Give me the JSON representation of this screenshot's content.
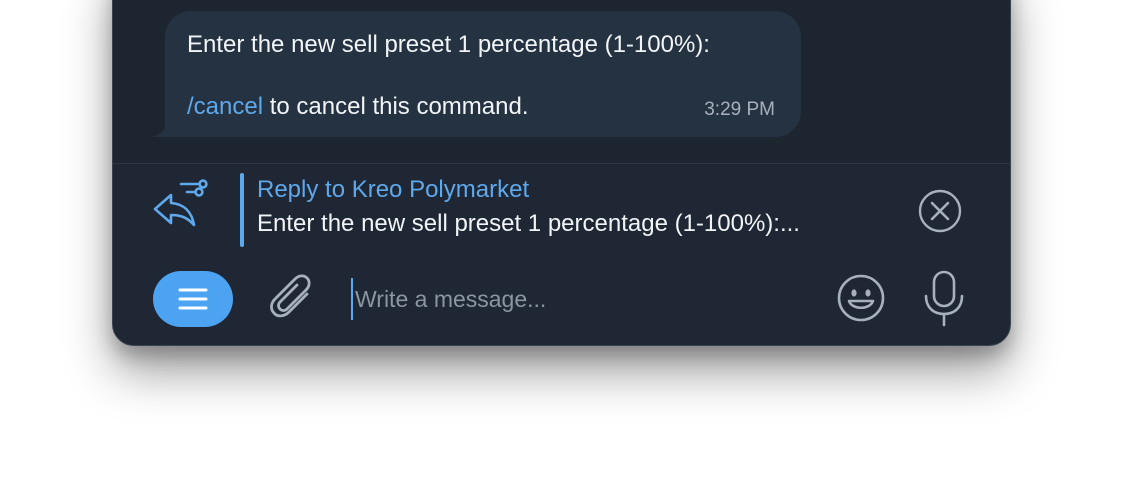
{
  "message": {
    "line1": "Enter the new sell preset 1 percentage (1-100%):",
    "command": "/cancel",
    "line2_suffix": " to cancel this command.",
    "time": "3:29 PM"
  },
  "reply": {
    "title": "Reply to Kreo Polymarket",
    "preview": "Enter the new sell preset 1 percentage (1-100%):..."
  },
  "composer": {
    "placeholder": "Write a message...",
    "value": ""
  },
  "icons": {
    "reply": "reply-options-icon",
    "close": "close-circle-icon",
    "menu": "menu-icon",
    "attach": "paperclip-icon",
    "emoji": "emoji-icon",
    "mic": "microphone-icon"
  },
  "colors": {
    "window_bg": "#1e2733",
    "bubble_bg": "#253241",
    "accent": "#5fa8ec",
    "menu_button": "#4ba3f2",
    "text": "#f2f5f8",
    "muted": "#a6b1bd"
  }
}
